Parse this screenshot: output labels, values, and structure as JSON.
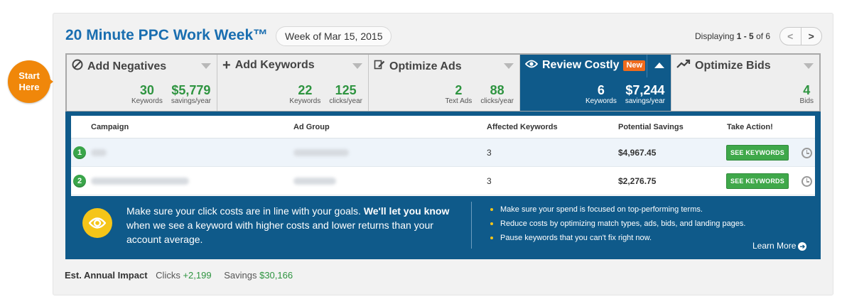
{
  "callout": {
    "line1": "Start",
    "line2": "Here"
  },
  "header": {
    "title": "20 Minute PPC Work Week™",
    "week": "Week of Mar 15, 2015",
    "displaying_prefix": "Displaying",
    "displaying_range": "1 - 5",
    "displaying_of": "of 6",
    "prev": "<",
    "next": ">"
  },
  "tabs": [
    {
      "label": "Add Negatives",
      "stats": [
        {
          "value": "30",
          "label": "Keywords"
        },
        {
          "value": "$5,779",
          "label": "savings/year"
        }
      ]
    },
    {
      "label": "Add Keywords",
      "stats": [
        {
          "value": "22",
          "label": "Keywords"
        },
        {
          "value": "125",
          "label": "clicks/year"
        }
      ]
    },
    {
      "label": "Optimize Ads",
      "stats": [
        {
          "value": "2",
          "label": "Text Ads"
        },
        {
          "value": "88",
          "label": "clicks/year"
        }
      ]
    },
    {
      "label": "Review Costly",
      "badge": "New",
      "stats": [
        {
          "value": "6",
          "label": "Keywords"
        },
        {
          "value": "$7,244",
          "label": "savings/year"
        }
      ]
    },
    {
      "label": "Optimize Bids",
      "stats": [
        {
          "value": "4",
          "label": "Bids"
        }
      ]
    }
  ],
  "table": {
    "columns": [
      "Campaign",
      "Ad Group",
      "Affected Keywords",
      "Potential Savings",
      "Take Action!"
    ],
    "rows": [
      {
        "index": "1",
        "affected": "3",
        "savings": "$4,967.45",
        "action": "SEE KEYWORDS"
      },
      {
        "index": "2",
        "affected": "3",
        "savings": "$2,276.75",
        "action": "SEE KEYWORDS"
      }
    ]
  },
  "info": {
    "text_a": "Make sure your click costs are in line with your goals. ",
    "text_b": "We'll let you know",
    "text_c": " when we see a keyword with higher costs and lower returns than your account average.",
    "bullets": [
      "Make sure your spend is focused on top-performing terms.",
      "Reduce costs by optimizing match types, ads, bids, and landing pages.",
      "Pause keywords that you can't fix right now."
    ],
    "learn_more": "Learn More"
  },
  "impact": {
    "label": "Est. Annual Impact",
    "clicks_label": "Clicks",
    "clicks_value": "+2,199",
    "savings_label": "Savings",
    "savings_value": "$30,166"
  },
  "colors": {
    "brand_blue": "#1a6eb0",
    "panel_blue": "#0f5a8a",
    "green": "#2e9440",
    "orange": "#f0870a",
    "yellow": "#f5c518"
  }
}
